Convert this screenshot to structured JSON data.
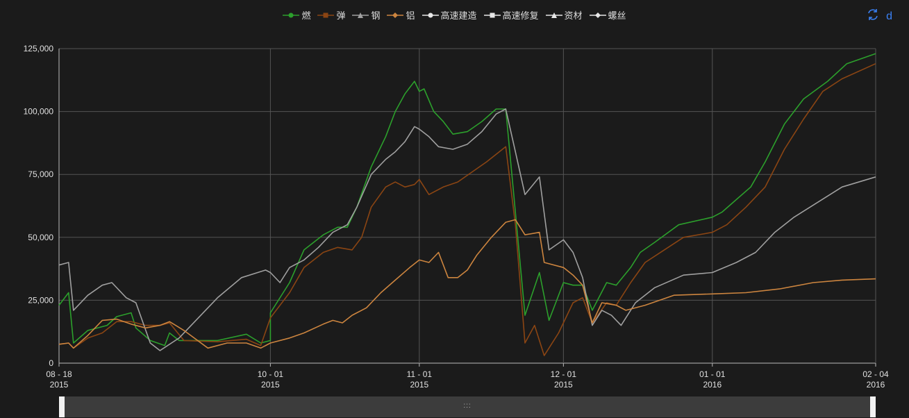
{
  "legend": [
    {
      "label": "燃",
      "color": "#2ca02c",
      "marker": "circle"
    },
    {
      "label": "弹",
      "color": "#8b4513",
      "marker": "rect"
    },
    {
      "label": "钢",
      "color": "#a0a0a0",
      "marker": "triangle"
    },
    {
      "label": "铝",
      "color": "#cd853f",
      "marker": "diamond"
    },
    {
      "label": "高速建造",
      "color": "#e8e8e8",
      "marker": "circle"
    },
    {
      "label": "高速修复",
      "color": "#e8e8e8",
      "marker": "rect"
    },
    {
      "label": "资材",
      "color": "#e8e8e8",
      "marker": "triangle"
    },
    {
      "label": "螺丝",
      "color": "#e8e8e8",
      "marker": "diamond"
    }
  ],
  "toolbox": {
    "refresh_icon": "refresh-icon",
    "data_view_label": "d"
  },
  "zoom": {
    "grip": ":::",
    "start_percent": 0,
    "end_percent": 100
  },
  "chart_data": {
    "type": "line",
    "x_range": [
      "2015-08-18",
      "2016-02-04"
    ],
    "ylim": [
      0,
      125000
    ],
    "y_ticks": [
      0,
      25000,
      50000,
      75000,
      100000,
      125000
    ],
    "y_tick_labels": [
      "0",
      "25,000",
      "50,000",
      "75,000",
      "100,000",
      "125,000"
    ],
    "x_ticks": [
      {
        "date": "2015-08-18",
        "line1": "08 - 18",
        "line2": "2015"
      },
      {
        "date": "2015-10-01",
        "line1": "10 - 01",
        "line2": "2015"
      },
      {
        "date": "2015-11-01",
        "line1": "11 - 01",
        "line2": "2015"
      },
      {
        "date": "2015-12-01",
        "line1": "12 - 01",
        "line2": "2015"
      },
      {
        "date": "2016-01-01",
        "line1": "01 - 01",
        "line2": "2016"
      },
      {
        "date": "2016-02-04",
        "line1": "02 - 04",
        "line2": "2016"
      }
    ],
    "grid": true,
    "legend_position": "top-center",
    "series": [
      {
        "name": "燃",
        "color": "#2ca02c",
        "points": [
          [
            "2015-08-18",
            23000
          ],
          [
            "2015-08-20",
            28000
          ],
          [
            "2015-08-21",
            8000
          ],
          [
            "2015-08-24",
            13000
          ],
          [
            "2015-08-28",
            15000
          ],
          [
            "2015-08-30",
            18500
          ],
          [
            "2015-09-02",
            20000
          ],
          [
            "2015-09-03",
            14000
          ],
          [
            "2015-09-06",
            9000
          ],
          [
            "2015-09-09",
            7000
          ],
          [
            "2015-09-10",
            12000
          ],
          [
            "2015-09-12",
            9000
          ],
          [
            "2015-09-20",
            9000
          ],
          [
            "2015-09-26",
            11500
          ],
          [
            "2015-10-01",
            9000
          ],
          [
            "2015-09-29",
            8000
          ],
          [
            "2015-10-01",
            20000
          ],
          [
            "2015-10-05",
            32000
          ],
          [
            "2015-10-08",
            45000
          ],
          [
            "2015-10-12",
            51000
          ],
          [
            "2015-10-15",
            54000
          ],
          [
            "2015-10-17",
            54000
          ],
          [
            "2015-10-19",
            62000
          ],
          [
            "2015-10-22",
            78000
          ],
          [
            "2015-10-25",
            90000
          ],
          [
            "2015-10-27",
            100000
          ],
          [
            "2015-10-29",
            107000
          ],
          [
            "2015-10-31",
            112000
          ],
          [
            "2015-11-01",
            108000
          ],
          [
            "2015-11-02",
            109000
          ],
          [
            "2015-11-04",
            100000
          ],
          [
            "2015-11-06",
            96000
          ],
          [
            "2015-11-08",
            91000
          ],
          [
            "2015-11-11",
            92000
          ],
          [
            "2015-11-14",
            96000
          ],
          [
            "2015-11-17",
            101000
          ],
          [
            "2015-11-19",
            101000
          ],
          [
            "2015-11-21",
            60000
          ],
          [
            "2015-11-23",
            19000
          ],
          [
            "2015-11-26",
            36000
          ],
          [
            "2015-11-28",
            17000
          ],
          [
            "2015-12-01",
            32000
          ],
          [
            "2015-12-03",
            31000
          ],
          [
            "2015-12-05",
            31000
          ],
          [
            "2015-12-07",
            21000
          ],
          [
            "2015-12-10",
            32000
          ],
          [
            "2015-12-12",
            31000
          ],
          [
            "2015-12-15",
            38000
          ],
          [
            "2015-12-17",
            44000
          ],
          [
            "2015-12-20",
            48000
          ],
          [
            "2015-12-25",
            55000
          ],
          [
            "2016-01-01",
            58000
          ],
          [
            "2016-01-03",
            60000
          ],
          [
            "2016-01-06",
            65000
          ],
          [
            "2016-01-09",
            70000
          ],
          [
            "2016-01-12",
            80000
          ],
          [
            "2016-01-16",
            95000
          ],
          [
            "2016-01-20",
            105000
          ],
          [
            "2016-01-25",
            112000
          ],
          [
            "2016-01-29",
            119000
          ],
          [
            "2016-02-04",
            123000
          ]
        ]
      },
      {
        "name": "弹",
        "color": "#8b4513",
        "points": [
          [
            "2015-08-18",
            7500
          ],
          [
            "2015-08-20",
            8000
          ],
          [
            "2015-08-21",
            6000
          ],
          [
            "2015-08-24",
            10000
          ],
          [
            "2015-08-27",
            12000
          ],
          [
            "2015-08-30",
            16500
          ],
          [
            "2015-09-02",
            16500
          ],
          [
            "2015-09-05",
            15000
          ],
          [
            "2015-09-08",
            15000
          ],
          [
            "2015-09-10",
            16000
          ],
          [
            "2015-09-13",
            9000
          ],
          [
            "2015-09-20",
            8500
          ],
          [
            "2015-09-26",
            9500
          ],
          [
            "2015-09-29",
            7000
          ],
          [
            "2015-10-01",
            18000
          ],
          [
            "2015-10-05",
            28000
          ],
          [
            "2015-10-08",
            38000
          ],
          [
            "2015-10-12",
            44000
          ],
          [
            "2015-10-15",
            46000
          ],
          [
            "2015-10-18",
            45000
          ],
          [
            "2015-10-20",
            50000
          ],
          [
            "2015-10-22",
            62000
          ],
          [
            "2015-10-25",
            70000
          ],
          [
            "2015-10-27",
            72000
          ],
          [
            "2015-10-29",
            70000
          ],
          [
            "2015-10-31",
            71000
          ],
          [
            "2015-11-01",
            73000
          ],
          [
            "2015-11-03",
            67000
          ],
          [
            "2015-11-06",
            70000
          ],
          [
            "2015-11-09",
            72000
          ],
          [
            "2015-11-12",
            76000
          ],
          [
            "2015-11-15",
            80000
          ],
          [
            "2015-11-19",
            86000
          ],
          [
            "2015-11-21",
            55000
          ],
          [
            "2015-11-23",
            8000
          ],
          [
            "2015-11-25",
            15000
          ],
          [
            "2015-11-27",
            3000
          ],
          [
            "2015-11-30",
            12000
          ],
          [
            "2015-12-03",
            24000
          ],
          [
            "2015-12-05",
            26000
          ],
          [
            "2015-12-07",
            16000
          ],
          [
            "2015-12-10",
            24000
          ],
          [
            "2015-12-12",
            23000
          ],
          [
            "2015-12-15",
            32000
          ],
          [
            "2015-12-18",
            40000
          ],
          [
            "2015-12-22",
            45000
          ],
          [
            "2015-12-26",
            50000
          ],
          [
            "2016-01-01",
            52000
          ],
          [
            "2016-01-04",
            55000
          ],
          [
            "2016-01-08",
            62000
          ],
          [
            "2016-01-12",
            70000
          ],
          [
            "2016-01-16",
            85000
          ],
          [
            "2016-01-20",
            97000
          ],
          [
            "2016-01-24",
            108000
          ],
          [
            "2016-01-28",
            113000
          ],
          [
            "2016-02-04",
            119000
          ]
        ]
      },
      {
        "name": "钢",
        "color": "#a0a0a0",
        "points": [
          [
            "2015-08-18",
            39000
          ],
          [
            "2015-08-20",
            40000
          ],
          [
            "2015-08-21",
            21000
          ],
          [
            "2015-08-24",
            27000
          ],
          [
            "2015-08-27",
            31000
          ],
          [
            "2015-08-29",
            32000
          ],
          [
            "2015-09-01",
            26000
          ],
          [
            "2015-09-03",
            24000
          ],
          [
            "2015-09-06",
            8000
          ],
          [
            "2015-09-08",
            5000
          ],
          [
            "2015-09-12",
            10000
          ],
          [
            "2015-09-20",
            26000
          ],
          [
            "2015-09-25",
            34000
          ],
          [
            "2015-09-30",
            37000
          ],
          [
            "2015-10-01",
            36000
          ],
          [
            "2015-10-03",
            32000
          ],
          [
            "2015-10-05",
            38000
          ],
          [
            "2015-10-08",
            41000
          ],
          [
            "2015-10-11",
            46000
          ],
          [
            "2015-10-14",
            52000
          ],
          [
            "2015-10-17",
            55000
          ],
          [
            "2015-10-19",
            62000
          ],
          [
            "2015-10-22",
            75000
          ],
          [
            "2015-10-25",
            81000
          ],
          [
            "2015-10-27",
            84000
          ],
          [
            "2015-10-29",
            88000
          ],
          [
            "2015-10-31",
            94000
          ],
          [
            "2015-11-01",
            93000
          ],
          [
            "2015-11-03",
            90000
          ],
          [
            "2015-11-05",
            86000
          ],
          [
            "2015-11-08",
            85000
          ],
          [
            "2015-11-11",
            87000
          ],
          [
            "2015-11-14",
            92000
          ],
          [
            "2015-11-17",
            99000
          ],
          [
            "2015-11-19",
            101000
          ],
          [
            "2015-11-21",
            84000
          ],
          [
            "2015-11-23",
            67000
          ],
          [
            "2015-11-26",
            74000
          ],
          [
            "2015-11-28",
            45000
          ],
          [
            "2015-12-01",
            49000
          ],
          [
            "2015-12-03",
            44000
          ],
          [
            "2015-12-05",
            34000
          ],
          [
            "2015-12-07",
            15000
          ],
          [
            "2015-12-09",
            21000
          ],
          [
            "2015-12-11",
            19000
          ],
          [
            "2015-12-13",
            15000
          ],
          [
            "2015-12-16",
            24000
          ],
          [
            "2015-12-20",
            30000
          ],
          [
            "2015-12-26",
            35000
          ],
          [
            "2016-01-01",
            36000
          ],
          [
            "2016-01-06",
            40000
          ],
          [
            "2016-01-10",
            44000
          ],
          [
            "2016-01-14",
            52000
          ],
          [
            "2016-01-18",
            58000
          ],
          [
            "2016-01-23",
            64000
          ],
          [
            "2016-01-28",
            70000
          ],
          [
            "2016-02-04",
            74000
          ]
        ]
      },
      {
        "name": "铝",
        "color": "#cd853f",
        "points": [
          [
            "2015-08-18",
            7500
          ],
          [
            "2015-08-20",
            8000
          ],
          [
            "2015-08-21",
            6000
          ],
          [
            "2015-08-24",
            11000
          ],
          [
            "2015-08-27",
            17000
          ],
          [
            "2015-08-30",
            17500
          ],
          [
            "2015-09-02",
            15500
          ],
          [
            "2015-09-05",
            14000
          ],
          [
            "2015-09-08",
            15000
          ],
          [
            "2015-09-10",
            16500
          ],
          [
            "2015-09-13",
            13000
          ],
          [
            "2015-09-18",
            6000
          ],
          [
            "2015-09-22",
            8000
          ],
          [
            "2015-09-26",
            8000
          ],
          [
            "2015-09-29",
            6000
          ],
          [
            "2015-10-01",
            8000
          ],
          [
            "2015-10-05",
            10000
          ],
          [
            "2015-10-08",
            12000
          ],
          [
            "2015-10-12",
            15500
          ],
          [
            "2015-10-14",
            17000
          ],
          [
            "2015-10-16",
            16000
          ],
          [
            "2015-10-18",
            19000
          ],
          [
            "2015-10-21",
            22000
          ],
          [
            "2015-10-24",
            28000
          ],
          [
            "2015-10-27",
            33000
          ],
          [
            "2015-10-30",
            38000
          ],
          [
            "2015-11-01",
            41000
          ],
          [
            "2015-11-03",
            40000
          ],
          [
            "2015-11-05",
            44000
          ],
          [
            "2015-11-07",
            34000
          ],
          [
            "2015-11-09",
            34000
          ],
          [
            "2015-11-11",
            37000
          ],
          [
            "2015-11-13",
            43000
          ],
          [
            "2015-11-16",
            50000
          ],
          [
            "2015-11-19",
            56000
          ],
          [
            "2015-11-21",
            57000
          ],
          [
            "2015-11-23",
            51000
          ],
          [
            "2015-11-26",
            52000
          ],
          [
            "2015-11-27",
            40000
          ],
          [
            "2015-12-01",
            38000
          ],
          [
            "2015-12-03",
            35000
          ],
          [
            "2015-12-05",
            31000
          ],
          [
            "2015-12-07",
            16000
          ],
          [
            "2015-12-09",
            24000
          ],
          [
            "2015-12-12",
            23000
          ],
          [
            "2015-12-14",
            21000
          ],
          [
            "2015-12-18",
            23000
          ],
          [
            "2015-12-24",
            27000
          ],
          [
            "2016-01-01",
            27500
          ],
          [
            "2016-01-08",
            28000
          ],
          [
            "2016-01-15",
            29500
          ],
          [
            "2016-01-22",
            32000
          ],
          [
            "2016-01-28",
            33000
          ],
          [
            "2016-02-04",
            33500
          ]
        ]
      }
    ]
  }
}
